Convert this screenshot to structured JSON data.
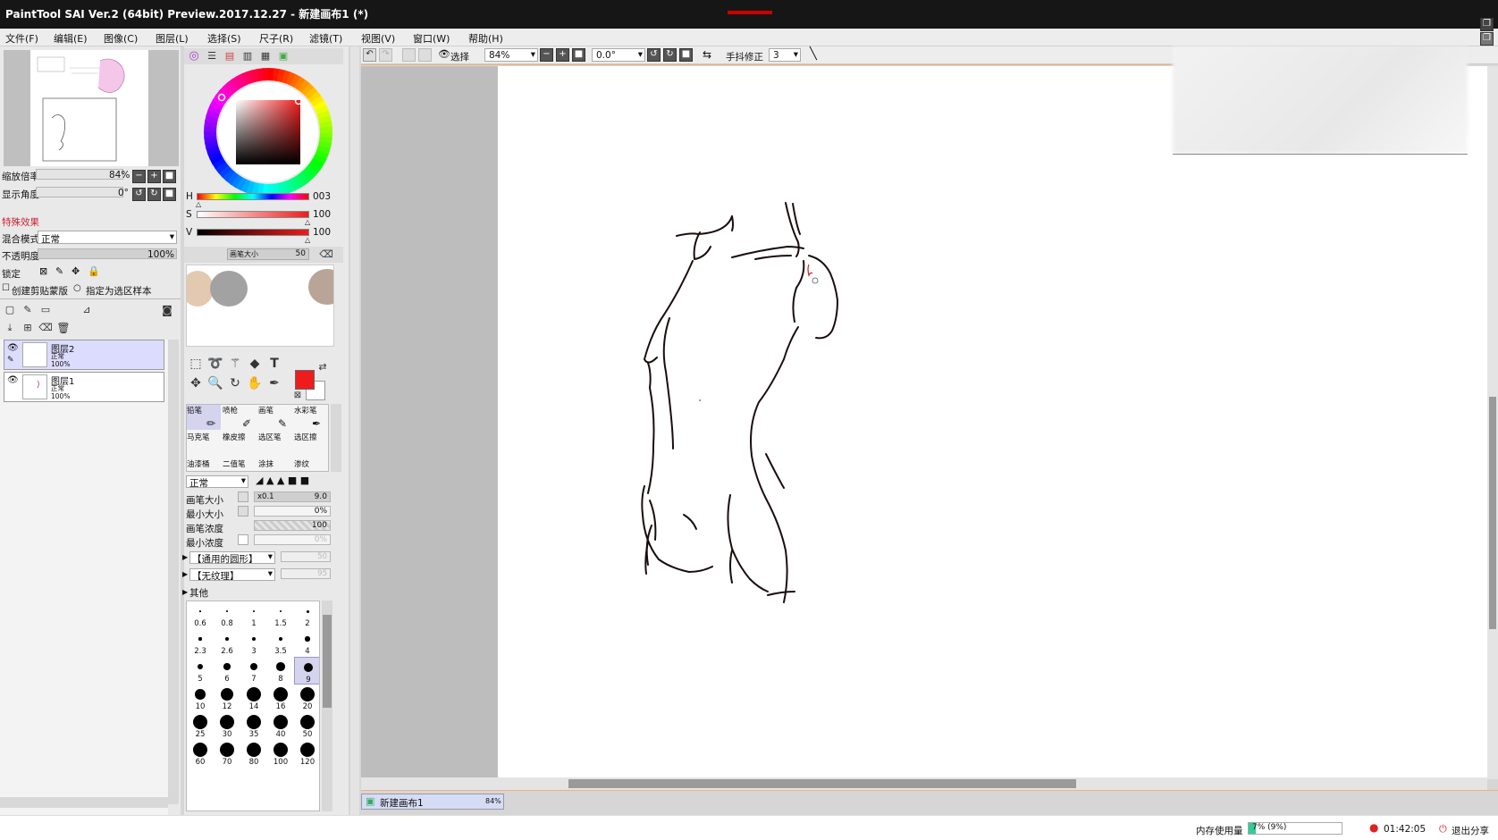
{
  "window": {
    "title": "PaintTool SAI Ver.2 (64bit) Preview.2017.12.27 - 新建画布1 (*)"
  },
  "menu": [
    {
      "label": "文件(F)"
    },
    {
      "label": "编辑(E)"
    },
    {
      "label": "图像(C)"
    },
    {
      "label": "图层(L)"
    },
    {
      "label": "选择(S)"
    },
    {
      "label": "尺子(R)"
    },
    {
      "label": "滤镜(T)"
    },
    {
      "label": "视图(V)"
    },
    {
      "label": "窗口(W)"
    },
    {
      "label": "帮助(H)"
    }
  ],
  "navigator": {
    "zoom_label": "缩放倍率",
    "zoom_value": "84%",
    "angle_label": "显示角度",
    "angle_value": "0°"
  },
  "layer_props": {
    "effects_label": "特殊效果",
    "blend_label": "混合模式",
    "blend_value": "正常",
    "opacity_label": "不透明度",
    "opacity_value": "100%",
    "lock_label": "锁定",
    "clip_label": "创建剪贴蒙版",
    "sample_label": "指定为选区样本"
  },
  "layers": [
    {
      "name": "图层2",
      "mode": "正常",
      "opacity": "100%",
      "selected": true
    },
    {
      "name": "图层1",
      "mode": "正常",
      "opacity": "100%",
      "selected": false
    }
  ],
  "color": {
    "h_label": "H",
    "h_value": "003",
    "s_label": "S",
    "s_value": "100",
    "v_label": "V",
    "v_value": "100",
    "h_level": 0.01,
    "s_level": 1.0,
    "v_level": 1.0,
    "current": "#ee1c1c",
    "swatch_size_label": "画笔大小",
    "swatch_size_value": "50"
  },
  "brushes": [
    {
      "label": "铅笔"
    },
    {
      "label": "喷枪"
    },
    {
      "label": "画笔"
    },
    {
      "label": "水彩笔"
    },
    {
      "label": "马克笔"
    },
    {
      "label": "橡皮擦"
    },
    {
      "label": "选区笔"
    },
    {
      "label": "选区擦"
    },
    {
      "label": "油漆桶"
    },
    {
      "label": "二值笔"
    },
    {
      "label": "涂抹"
    },
    {
      "label": "渗纹"
    }
  ],
  "brush_settings": {
    "mode_value": "正常",
    "size_label": "画笔大小",
    "size_mult": "x0.1",
    "size_value": "9.0",
    "min_size_label": "最小大小",
    "min_size_value": "0%",
    "density_label": "画笔浓度",
    "density_value": "100",
    "min_density_label": "最小浓度",
    "min_density_value": "0%",
    "shape_value": "【通用的圆形】",
    "shape_num": "50",
    "texture_value": "【无纹理】",
    "texture_num": "95",
    "other_label": "其他"
  },
  "brush_sizes": [
    "0.6",
    "0.8",
    "1",
    "1.5",
    "2",
    "2.3",
    "2.6",
    "3",
    "3.5",
    "4",
    "5",
    "6",
    "7",
    "8",
    "9",
    "10",
    "12",
    "14",
    "16",
    "20",
    "25",
    "30",
    "35",
    "40",
    "50",
    "60",
    "70",
    "80",
    "100",
    "120"
  ],
  "toolbar": {
    "select_label": "选择",
    "zoom_value": "84%",
    "angle_value": "0.0°",
    "stabilizer_label": "手抖修正",
    "stabilizer_value": "3"
  },
  "canvas_tab": {
    "name": "新建画布1",
    "zoom": "84%"
  },
  "status": {
    "memory_label": "内存使用量",
    "memory_value": "7% (9%)",
    "time": "01:42:05",
    "exit_label": "退出分享"
  }
}
